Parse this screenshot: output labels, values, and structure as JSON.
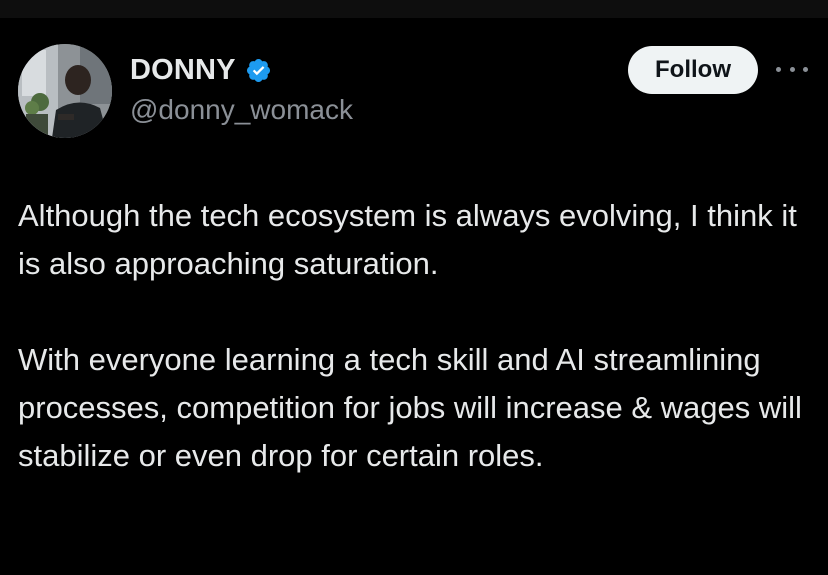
{
  "author": {
    "display_name": "DONNY",
    "handle": "@donny_womack",
    "verified_icon": "verified-badge-icon",
    "verified_color": "#1d9bf0"
  },
  "actions": {
    "follow_label": "Follow",
    "more_icon": "more-options-icon"
  },
  "tweet": {
    "paragraphs": [
      "Although the tech ecosystem is always evolving, I think it is also approaching saturation.",
      "With everyone learning a tech skill and AI streamlining processes, competition for jobs will increase & wages will stabilize or even drop for certain roles."
    ]
  },
  "colors": {
    "background": "#000000",
    "text_primary": "#e7e9ea",
    "text_secondary": "#8b9097",
    "button_bg": "#eff3f4"
  }
}
